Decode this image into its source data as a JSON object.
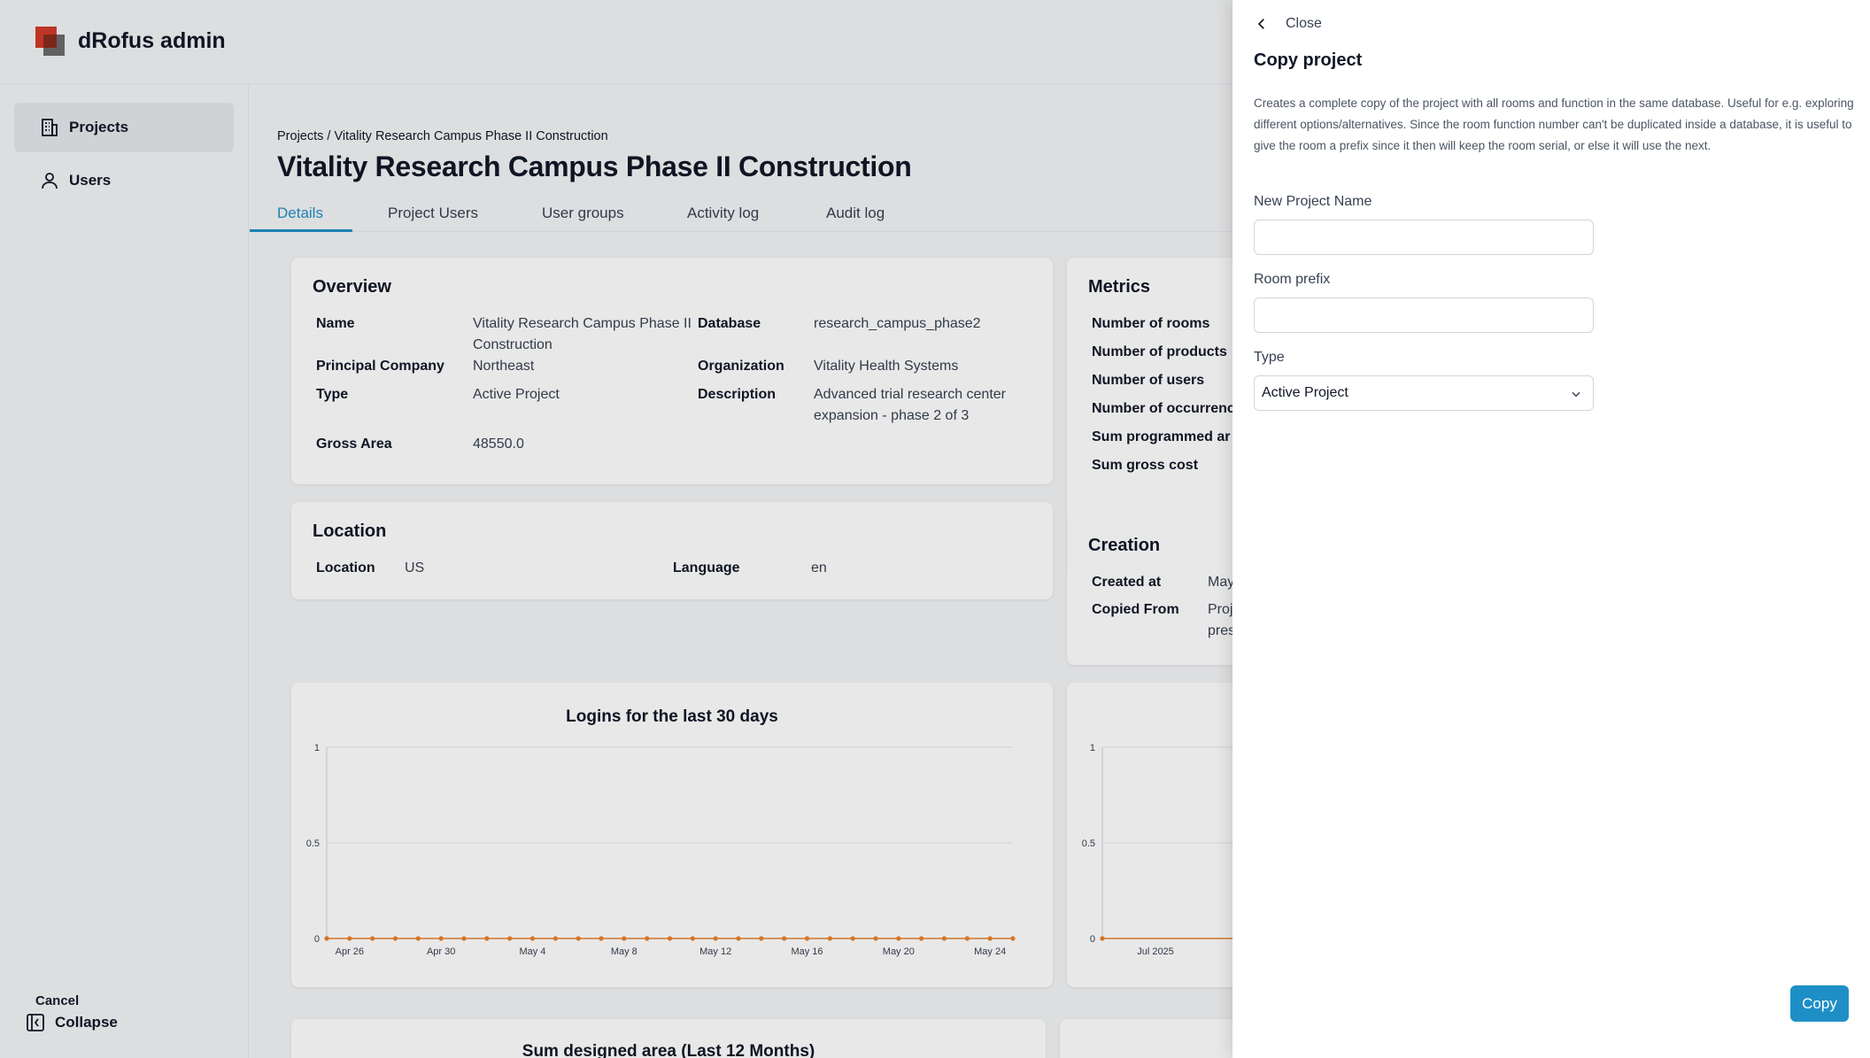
{
  "app": {
    "brand": "dRofus admin"
  },
  "sidebar": {
    "items": [
      {
        "label": "Projects",
        "icon": "building-icon",
        "active": true
      },
      {
        "label": "Users",
        "icon": "user-icon",
        "active": false
      }
    ],
    "collapse_label": "Collapse"
  },
  "page": {
    "breadcrumb": "Projects / Vitality Research Campus Phase II Construction",
    "title": "Vitality Research Campus Phase II Construction",
    "tabs": [
      "Details",
      "Project Users",
      "User groups",
      "Activity log",
      "Audit log"
    ],
    "active_tab": "Details"
  },
  "overview": {
    "title": "Overview",
    "name_label": "Name",
    "name_value": "Vitality Research Campus Phase II Construction",
    "database_label": "Database",
    "database_value": "research_campus_phase2",
    "principal_label": "Principal Company",
    "principal_value": "Northeast",
    "organization_label": "Organization",
    "organization_value": "Vitality Health Systems",
    "type_label": "Type",
    "type_value": "Active Project",
    "description_label": "Description",
    "description_value": "Advanced trial research center expansion - phase 2 of 3",
    "gross_area_label": "Gross Area",
    "gross_area_value": "48550.0"
  },
  "location": {
    "title": "Location",
    "location_label": "Location",
    "location_value": "US",
    "language_label": "Language",
    "language_value": "en"
  },
  "metrics": {
    "title": "Metrics",
    "rows": [
      "Number of rooms",
      "Number of products",
      "Number of users",
      "Number of occurrenc",
      "Sum programmed ar",
      "Sum gross cost"
    ]
  },
  "creation": {
    "title": "Creation",
    "created_label": "Created at",
    "created_value": "May",
    "copied_label": "Copied From",
    "copied_value_1": "Proj",
    "copied_value_2": "pres"
  },
  "next_section_title": "Sum designed area (Last 12 Months)",
  "chart_data": [
    {
      "type": "line",
      "title": "Logins for the last 30 days",
      "x": [
        "Apr 25",
        "Apr 26",
        "Apr 27",
        "Apr 28",
        "Apr 29",
        "Apr 30",
        "May 1",
        "May 2",
        "May 3",
        "May 4",
        "May 5",
        "May 6",
        "May 7",
        "May 8",
        "May 9",
        "May 10",
        "May 11",
        "May 12",
        "May 13",
        "May 14",
        "May 15",
        "May 16",
        "May 17",
        "May 18",
        "May 19",
        "May 20",
        "May 21",
        "May 22",
        "May 23",
        "May 24",
        "May 25"
      ],
      "x_tick_labels": [
        "Apr 26",
        "Apr 30",
        "May 4",
        "May 8",
        "May 12",
        "May 16",
        "May 20",
        "May 24"
      ],
      "values": [
        0,
        0,
        0,
        0,
        0,
        0,
        0,
        0,
        0,
        0,
        0,
        0,
        0,
        0,
        0,
        0,
        0,
        0,
        0,
        0,
        0,
        0,
        0,
        0,
        0,
        0,
        0,
        0,
        0,
        0,
        0
      ],
      "ylim": [
        0,
        1
      ],
      "y_ticks": [
        "1",
        "0.5",
        "0"
      ],
      "color": "#e8812d",
      "grid": true
    },
    {
      "type": "line",
      "title": "",
      "x_tick_labels": [
        "Jul 2025"
      ],
      "values": [
        0,
        0
      ],
      "ylim": [
        0,
        1
      ],
      "y_ticks": [
        "1",
        "0.5",
        "0"
      ],
      "color": "#e8812d",
      "grid": true
    }
  ],
  "drawer": {
    "close_label": "Close",
    "title": "Copy project",
    "description": "Creates a complete copy of the project with all rooms and function in the same database. Useful for e.g. exploring different options/alternatives. Since the room function number can't be duplicated inside a database, it is useful to give the room a prefix since it then will keep the room serial, or else it will use the next.",
    "new_name_label": "New Project Name",
    "new_name_value": "",
    "prefix_label": "Room prefix",
    "prefix_value": "",
    "type_label": "Type",
    "type_value": "Active Project",
    "cancel_label": "Cancel",
    "copy_label": "Copy",
    "accent": "#1e8fc6"
  }
}
